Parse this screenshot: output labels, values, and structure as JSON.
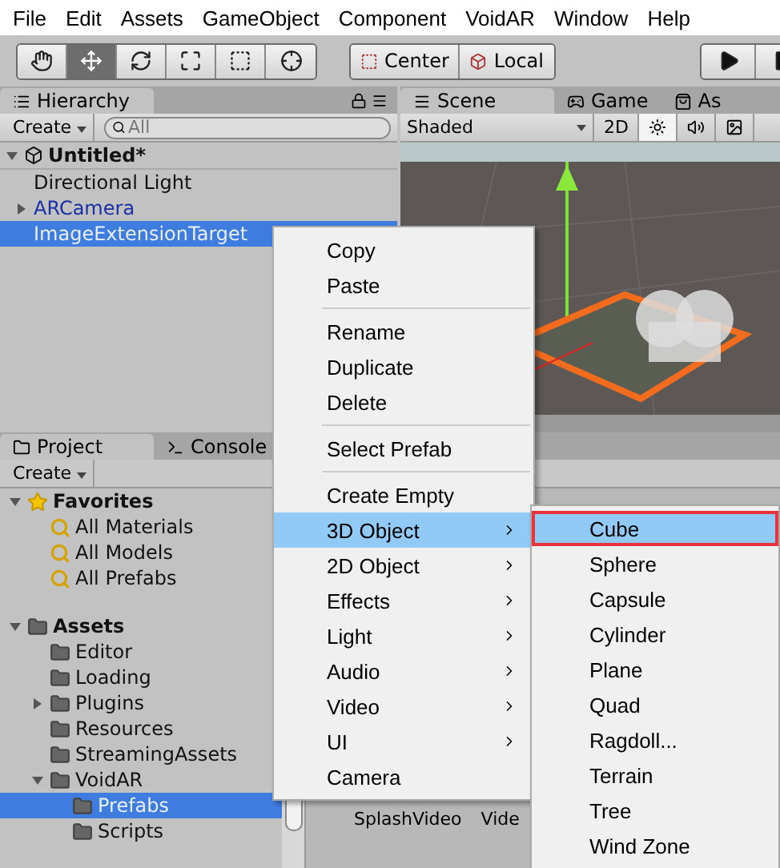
{
  "menu_bar": [
    "File",
    "Edit",
    "Assets",
    "GameObject",
    "Component",
    "VoidAR",
    "Window",
    "Help"
  ],
  "toolbar": {
    "tools": [
      {
        "kind": "hand",
        "selected": false
      },
      {
        "kind": "move",
        "selected": true
      },
      {
        "kind": "rotate",
        "selected": false
      },
      {
        "kind": "scale",
        "selected": false
      },
      {
        "kind": "rect",
        "selected": false
      },
      {
        "kind": "transform",
        "selected": false
      }
    ],
    "pivot": [
      {
        "kind": "center",
        "label": "Center"
      },
      {
        "kind": "local",
        "label": "Local"
      }
    ],
    "playback": [
      {
        "kind": "play"
      },
      {
        "kind": "pause"
      }
    ]
  },
  "hierarchy": {
    "tab": "Hierarchy",
    "create": "Create",
    "search": {
      "placeholder": "All"
    },
    "scene": {
      "name": "Untitled*",
      "expanded": true,
      "children": [
        {
          "name": "Directional Light",
          "prefab": false,
          "selected": false
        },
        {
          "name": "ARCamera",
          "prefab": true,
          "expanded": false,
          "selected": false
        },
        {
          "name": "ImageExtensionTarget",
          "prefab": true,
          "selected": true
        }
      ]
    }
  },
  "scene_view": {
    "tabs": [
      {
        "kind": "scene",
        "label": "Scene",
        "selected": true
      },
      {
        "kind": "game",
        "label": "Game",
        "selected": false
      },
      {
        "kind": "store",
        "label": "As",
        "selected": false
      }
    ],
    "shading": "Shaded",
    "mode_2d": {
      "label": "2D",
      "on": false
    },
    "lighting": {
      "on": true
    }
  },
  "project": {
    "tabs": [
      {
        "kind": "project",
        "label": "Project",
        "selected": true
      },
      {
        "kind": "console",
        "label": "Console",
        "selected": false
      }
    ],
    "create": "Create",
    "tree": [
      {
        "name": "Favorites",
        "kind": "favorites",
        "expanded": true,
        "children": [
          {
            "name": "All Materials",
            "kind": "search"
          },
          {
            "name": "All Models",
            "kind": "search"
          },
          {
            "name": "All Prefabs",
            "kind": "search"
          }
        ]
      },
      {
        "name": "Assets",
        "kind": "folder",
        "expanded": true,
        "children": [
          {
            "name": "Editor",
            "kind": "folder"
          },
          {
            "name": "Loading",
            "kind": "folder"
          },
          {
            "name": "Plugins",
            "kind": "folder",
            "expanded": false
          },
          {
            "name": "Resources",
            "kind": "folder"
          },
          {
            "name": "StreamingAssets",
            "kind": "folder"
          },
          {
            "name": "VoidAR",
            "kind": "folder",
            "expanded": true,
            "children": [
              {
                "name": "Prefabs",
                "kind": "folder",
                "selected": true
              },
              {
                "name": "Scripts",
                "kind": "folder",
                "selected": false
              }
            ]
          }
        ]
      }
    ],
    "assets": [
      "SplashVideo",
      "Vide"
    ]
  },
  "context_menu": {
    "groups": [
      [
        {
          "label": "Copy"
        },
        {
          "label": "Paste"
        }
      ],
      [
        {
          "label": "Rename"
        },
        {
          "label": "Duplicate"
        },
        {
          "label": "Delete"
        }
      ],
      [
        {
          "label": "Select Prefab"
        }
      ],
      [
        {
          "label": "Create Empty",
          "submenu": false,
          "selected": false
        },
        {
          "label": "3D Object",
          "submenu": true,
          "selected": true
        },
        {
          "label": "2D Object",
          "submenu": true,
          "selected": false
        },
        {
          "label": "Effects",
          "submenu": true,
          "selected": false
        },
        {
          "label": "Light",
          "submenu": true,
          "selected": false
        },
        {
          "label": "Audio",
          "submenu": true,
          "selected": false
        },
        {
          "label": "Video",
          "submenu": true,
          "selected": false
        },
        {
          "label": "UI",
          "submenu": true,
          "selected": false
        },
        {
          "label": "Camera",
          "submenu": false,
          "selected": false
        }
      ]
    ]
  },
  "submenu": [
    {
      "label": "Cube",
      "selected": true,
      "highlighted": true
    },
    {
      "label": "Sphere",
      "selected": false,
      "highlighted": false
    },
    {
      "label": "Capsule",
      "selected": false,
      "highlighted": false
    },
    {
      "label": "Cylinder",
      "selected": false,
      "highlighted": false
    },
    {
      "label": "Plane",
      "selected": false,
      "highlighted": false
    },
    {
      "label": "Quad",
      "selected": false,
      "highlighted": false
    },
    {
      "label": "Ragdoll...",
      "selected": false,
      "highlighted": false
    },
    {
      "label": "Terrain",
      "selected": false,
      "highlighted": false
    },
    {
      "label": "Tree",
      "selected": false,
      "highlighted": false
    },
    {
      "label": "Wind Zone",
      "selected": false,
      "highlighted": false
    }
  ]
}
